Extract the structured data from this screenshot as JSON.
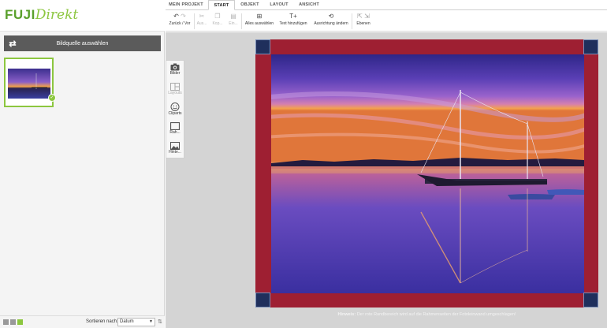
{
  "logo": {
    "part1": "FUJI",
    "part2": "Direkt"
  },
  "left_panel": {
    "source_label": "Bildquelle auswählen",
    "sort_label": "Sortieren nach:",
    "sort_value": "Datum"
  },
  "tabs": [
    {
      "label": "MEIN PROJEKT"
    },
    {
      "label": "START",
      "active": true
    },
    {
      "label": "OBJEKT"
    },
    {
      "label": "LAYOUT"
    },
    {
      "label": "ANSICHT"
    }
  ],
  "toolbar": {
    "undo_redo": "Zurück / Vor",
    "cut": "Aus...",
    "copy": "Kop...",
    "paste": "Ein...",
    "select_all": "Alles auswählen",
    "add_text": "Text hinzufügen",
    "change_orientation": "Ausrichtung ändern",
    "layers": "Ebenen"
  },
  "palette": {
    "images": "Bilder",
    "layouts": "Layouts",
    "cliparts": "Cliparts",
    "frames": "Rah...",
    "backgrounds": "Hinte..."
  },
  "note": {
    "label": "Hinweis:",
    "text": "Der rote Randbereich wird auf die Rahmenseiten der Fotoleinwand umgeschlagen!"
  },
  "colors": {
    "accent_green": "#8cc63f",
    "frame_red": "#9e1f32",
    "corner_blue": "#1f2f5c"
  }
}
